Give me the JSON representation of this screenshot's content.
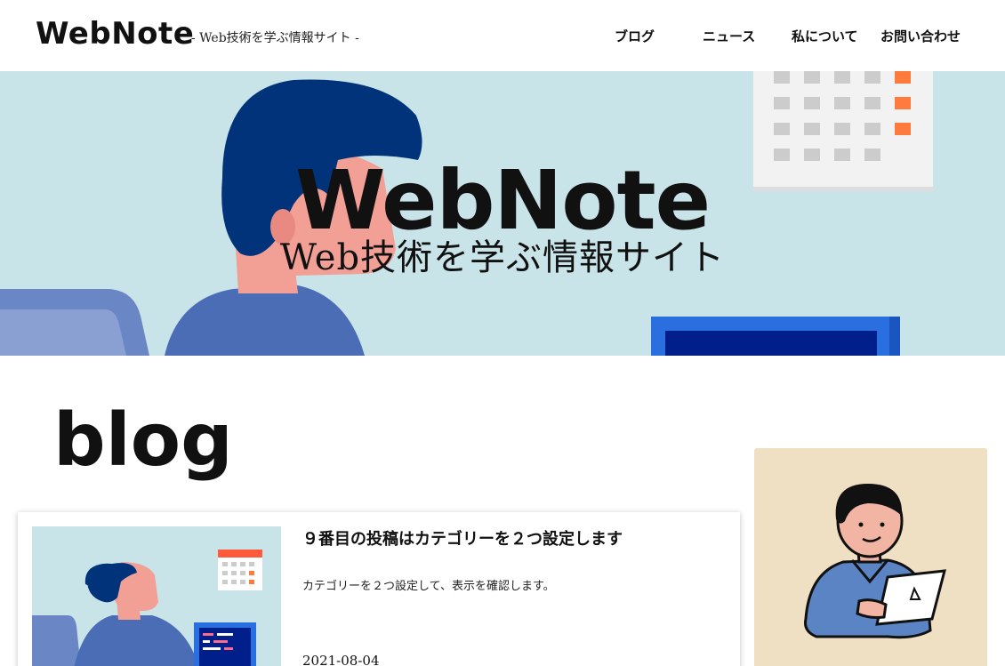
{
  "header": {
    "logo": "WebNote",
    "tagline": "- Web技術を学ぶ情報サイト -",
    "nav": [
      {
        "label": "ブログ"
      },
      {
        "label": "ニュース"
      },
      {
        "label": "私について"
      },
      {
        "label": "お問い合わせ"
      }
    ]
  },
  "hero": {
    "title": "WebNote",
    "subtitle": "Web技術を学ぶ情報サイト"
  },
  "main": {
    "section_title": "blog",
    "posts": [
      {
        "title": "９番目の投稿はカテゴリーを２つ設定します",
        "excerpt": "カテゴリーを２つ設定して、表示を確認します。",
        "date": "2021-08-04"
      }
    ]
  },
  "colors": {
    "hero_bg": "#c9e4e8",
    "profile_bg": "#efdfc3",
    "accent_orange": "#ff7a3d",
    "shirt_blue": "#4a6db5",
    "hair_navy": "#00337a"
  }
}
